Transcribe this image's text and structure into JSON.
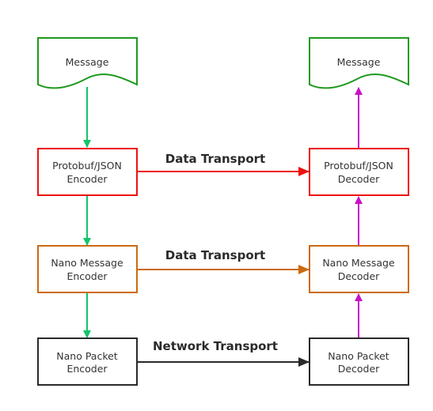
{
  "diagram": {
    "colors": {
      "document": "#1f9a1f",
      "protobuf": "#ee1111",
      "nano_message": "#cc6a10",
      "nano_packet": "#2a2a2a",
      "encode_flow": "#11c46a",
      "decode_flow": "#c811c8"
    },
    "nodes": {
      "message_left": {
        "label": "Message"
      },
      "message_right": {
        "label": "Message"
      },
      "protobuf_encoder": {
        "line1": "Protobuf/JSON",
        "line2": "Encoder"
      },
      "protobuf_decoder": {
        "line1": "Protobuf/JSON",
        "line2": "Decoder"
      },
      "nano_message_encoder": {
        "line1": "Nano Message",
        "line2": "Encoder"
      },
      "nano_message_decoder": {
        "line1": "Nano Message",
        "line2": "Decoder"
      },
      "nano_packet_encoder": {
        "line1": "Nano Packet",
        "line2": "Encoder"
      },
      "nano_packet_decoder": {
        "line1": "Nano Packet",
        "line2": "Decoder"
      }
    },
    "edges": {
      "protobuf_transport": {
        "label": "Data Transport"
      },
      "nano_message_transport": {
        "label": "Data Transport"
      },
      "nano_packet_transport": {
        "label": "Network Transport"
      }
    }
  }
}
